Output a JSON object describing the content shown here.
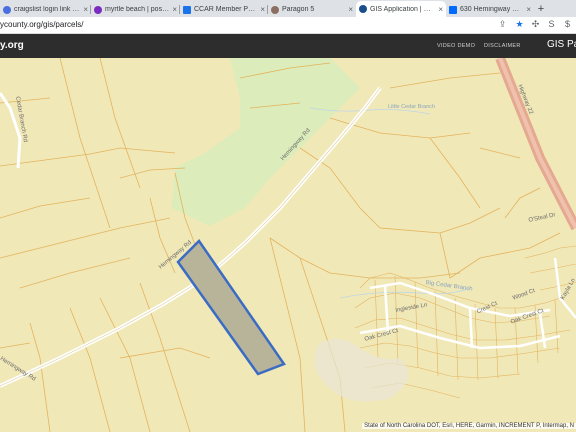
{
  "browser": {
    "tabs": [
      {
        "title": "craigslist login link - h",
        "icon": "globe-icon",
        "color": "#4a6ee0"
      },
      {
        "title": "myrtle beach | posting",
        "icon": "peace-icon",
        "color": "#7b2cbf"
      },
      {
        "title": "CCAR Member Portal",
        "icon": "document-icon",
        "color": "#1a73e8"
      },
      {
        "title": "Paragon 5",
        "icon": "rainbow-icon",
        "color": "#8d6e63"
      },
      {
        "title": "GIS Application | Horr",
        "icon": "gis-icon",
        "color": "#1a4f8b",
        "active": true
      },
      {
        "title": "630 Hemingway Rd - (",
        "icon": "zillow-icon",
        "color": "#006aff"
      }
    ],
    "close_glyph": "×",
    "new_tab_glyph": "+",
    "url": "ycounty.org/gis/parcels/",
    "toolbar_icons": [
      "share-icon",
      "star-icon",
      "puzzle-icon",
      "s-extension-icon",
      "dollar-extension-icon",
      "sidebar-icon"
    ]
  },
  "app": {
    "brand": "y.org",
    "nav": [
      "VIDEO DEMO",
      "DISCLAIMER"
    ],
    "title": "GIS Parcels"
  },
  "map": {
    "labels": {
      "cedar_branch_rd": "Cedar Branch Rd",
      "hemingway_rd_mid": "Hemingway Rd",
      "hemingway_rd_lower": "Hemingway Rd",
      "hemingway_rd_left": "Hemingway Rd",
      "little_cedar_branch": "Little Cedar Branch",
      "highway_22": "Highway 22",
      "o_steel_dr": "O'Steal Dr",
      "big_cedar_branch": "Big Cedar Branch",
      "ingleside_ln": "Ingleside Ln",
      "oak_crest_ct_left": "Oak Crest Ct",
      "oak_crest_ct_right": "Oak Crest Ct",
      "crest_ct": "Crest Ct",
      "wood_ct": "Wood Ct",
      "kayla_ln": "Kayla Ln"
    },
    "attribution": "State of North Carolina DOT, Esri, HERE, Garmin, INCREMENT P, Intermap, N",
    "colors": {
      "parcel_fill": "#f1e8b8",
      "parcel_line": "#e3b35c",
      "green_area": "#dcecba",
      "road": "#ffffff",
      "highway": "#e4a990",
      "selected_fill": "#b8b49a",
      "selected_line": "#3b6cc4"
    }
  }
}
